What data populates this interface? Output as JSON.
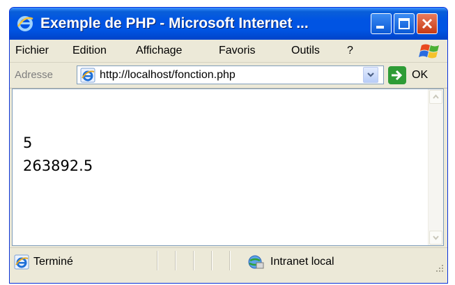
{
  "window": {
    "title": "Exemple de PHP - Microsoft Internet ..."
  },
  "menu": {
    "items": [
      "Fichier",
      "Edition",
      "Affichage",
      "Favoris",
      "Outils",
      "?"
    ]
  },
  "address": {
    "label": "Adresse",
    "url": "http://localhost/fonction.php",
    "go_label": "OK"
  },
  "content": {
    "lines": [
      "5",
      "263892.5"
    ]
  },
  "status": {
    "text": "Terminé",
    "zone": "Intranet local"
  },
  "icons": {
    "browser": "ie-logo-icon",
    "minimize": "minimize-icon",
    "maximize": "maximize-icon",
    "close": "close-icon",
    "windows_flag": "windows-flag-icon",
    "go": "go-arrow-icon",
    "zone": "intranet-zone-icon"
  },
  "colors": {
    "titlebar": "#0054E3",
    "close_button": "#C73A14",
    "chrome": "#ECE9D8",
    "go_arrow": "#2E9C36"
  }
}
